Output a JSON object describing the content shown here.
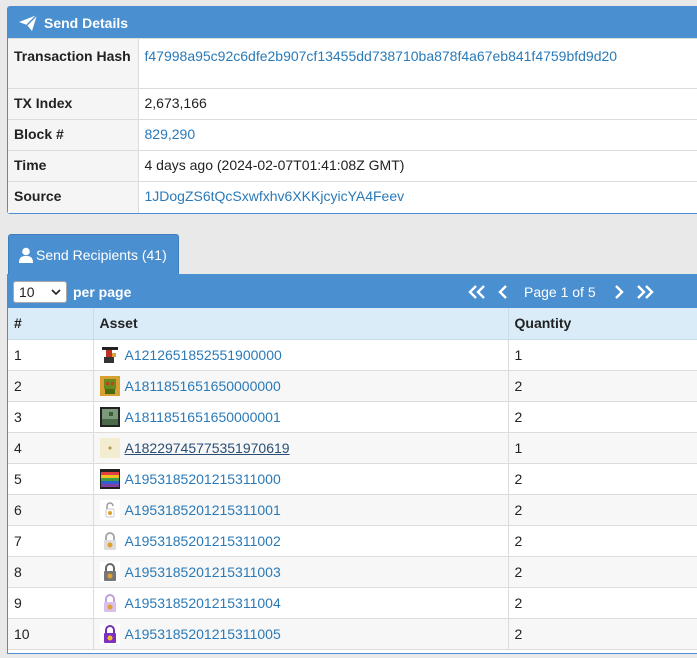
{
  "details": {
    "title": "Send Details",
    "rows": [
      {
        "label": "Transaction Hash",
        "value": "f47998a95c92c6dfe2b907cf13455dd738710ba878f4a67eb841f4759bfd9d20",
        "link": true
      },
      {
        "label": "TX Index",
        "value": "2,673,166",
        "link": false
      },
      {
        "label": "Block #",
        "value": "829,290",
        "link": true
      },
      {
        "label": "Time",
        "value": "4 days ago (2024-02-07T01:41:08Z GMT)",
        "link": false
      },
      {
        "label": "Source",
        "value": "1JDogZS6tQcSxwfxhv6XKKjcyicYA4Feev",
        "link": true
      }
    ]
  },
  "recipients": {
    "tab_label": "Send Recipients (41)",
    "page_size": "10",
    "per_page_label": "per page",
    "page_label": "Page 1 of 5",
    "columns": [
      "#",
      "Asset",
      "Quantity"
    ],
    "rows": [
      {
        "num": "1",
        "asset": "A1212651852551900000",
        "qty": "1",
        "icon": "pixel-art-icon"
      },
      {
        "num": "2",
        "asset": "A1811851651650000000",
        "qty": "2",
        "icon": "pixel-art-icon"
      },
      {
        "num": "3",
        "asset": "A1811851651650000001",
        "qty": "2",
        "icon": "pixel-art-icon"
      },
      {
        "num": "4",
        "asset": "A18229745775351970619",
        "qty": "1",
        "icon": "dot-icon"
      },
      {
        "num": "5",
        "asset": "A1953185201215311000",
        "qty": "2",
        "icon": "stripes-icon"
      },
      {
        "num": "6",
        "asset": "A1953185201215311001",
        "qty": "2",
        "icon": "lock-icon"
      },
      {
        "num": "7",
        "asset": "A1953185201215311002",
        "qty": "2",
        "icon": "lock-icon"
      },
      {
        "num": "8",
        "asset": "A1953185201215311003",
        "qty": "2",
        "icon": "lock-icon"
      },
      {
        "num": "9",
        "asset": "A1953185201215311004",
        "qty": "2",
        "icon": "lock-icon"
      },
      {
        "num": "10",
        "asset": "A1953185201215311005",
        "qty": "2",
        "icon": "lock-icon"
      }
    ]
  },
  "colors": {
    "header_blue": "#4a8fd0",
    "link": "#2a7ab8",
    "table_head": "#d9ecf7"
  }
}
